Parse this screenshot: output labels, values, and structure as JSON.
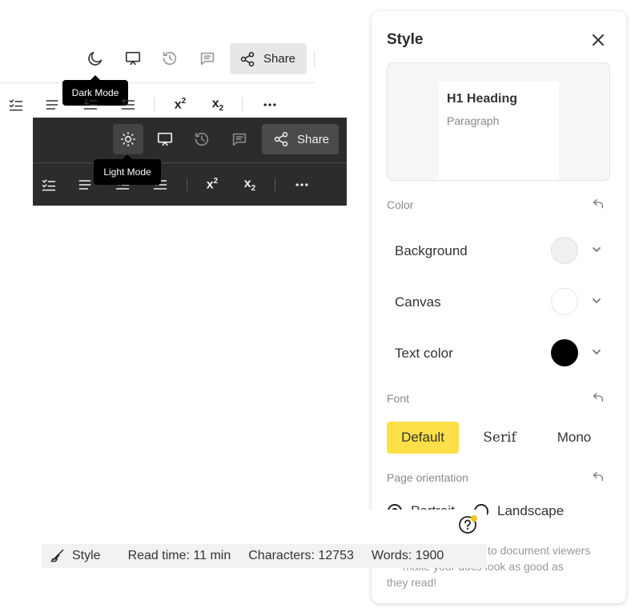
{
  "light_toolbar": {
    "share_label": "Share",
    "tooltip": "Dark Mode",
    "icons": [
      "moon-icon",
      "presentation-icon",
      "history-icon",
      "comment-icon",
      "share-icon",
      "checklist-icon",
      "align-icon",
      "indent-decrease-icon",
      "indent-increase-icon",
      "superscript-icon",
      "subscript-icon",
      "more-icon"
    ],
    "superscript": "x",
    "superscript_mark": "2",
    "subscript": "x",
    "subscript_mark": "2"
  },
  "dark_toolbar": {
    "share_label": "Share",
    "tooltip": "Light Mode",
    "icons": [
      "sun-icon",
      "presentation-icon",
      "history-icon",
      "comment-icon",
      "share-icon",
      "checklist-icon",
      "align-icon",
      "indent-decrease-icon",
      "indent-increase-icon",
      "superscript-icon",
      "subscript-icon",
      "more-icon"
    ],
    "superscript": "x",
    "superscript_mark": "2",
    "subscript": "x",
    "subscript_mark": "2"
  },
  "status_bar": {
    "style_label": "Style",
    "read_time": "Read time: 11 min",
    "characters": "Characters: 12753",
    "words": "Words: 1900"
  },
  "style_panel": {
    "title": "Style",
    "preview": {
      "heading": "H1 Heading",
      "paragraph": "Paragraph"
    },
    "color_section": {
      "label": "Color",
      "rows": [
        {
          "label": "Background",
          "swatch": "#f0f0f0"
        },
        {
          "label": "Canvas",
          "swatch": "#ffffff"
        },
        {
          "label": "Text color",
          "swatch": "#000000"
        }
      ]
    },
    "font_section": {
      "label": "Font",
      "options": [
        "Default",
        "Serif",
        "Mono"
      ],
      "selected": "Default"
    },
    "orientation_section": {
      "label": "Page orientation",
      "options": [
        "Portrait",
        "Landscape"
      ],
      "selected": "Portrait"
    },
    "hint_text": [
      "to document viewers",
      "make your docs look as good as",
      "they read!"
    ]
  },
  "colors": {
    "accent_yellow": "#fde047",
    "dark_bg": "#2c2c2c",
    "tooltip_bg": "#000000",
    "notification_dot": "#f5c518"
  }
}
